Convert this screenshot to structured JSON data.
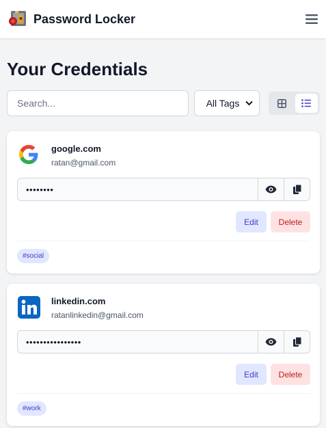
{
  "app": {
    "title": "Password Locker",
    "logo": "password-locker-logo",
    "menu_icon": "hamburger-menu-icon"
  },
  "page": {
    "heading": "Your Credentials"
  },
  "toolbar": {
    "search_placeholder": "Search...",
    "tag_filter": {
      "selected": "All Tags"
    },
    "view_modes": [
      {
        "name": "grid-view",
        "icon": "grid-icon",
        "active": false
      },
      {
        "name": "list-view",
        "icon": "list-icon",
        "active": true
      }
    ]
  },
  "credentials": [
    {
      "site": "google.com",
      "username": "ratan@gmail.com",
      "password_masked": "••••••••",
      "icon": "google-logo",
      "tag": "#social",
      "edit_label": "Edit",
      "delete_label": "Delete"
    },
    {
      "site": "linkedin.com",
      "username": "ratanlinkedin@gmail.com",
      "password_masked": "••••••••••••••••",
      "icon": "linkedin-logo",
      "tag": "#work",
      "edit_label": "Edit",
      "delete_label": "Delete"
    }
  ],
  "colors": {
    "accent": "#4338ca",
    "accent_bg": "#e0e7ff",
    "danger": "#b91c1c",
    "danger_bg": "#fee2e2",
    "page_bg": "#f3f4f6"
  }
}
